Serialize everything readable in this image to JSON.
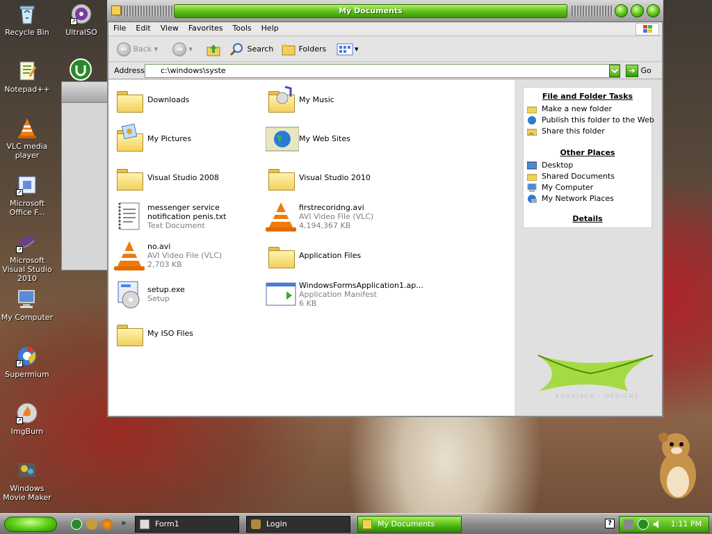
{
  "desktop": {
    "icons": [
      {
        "label": "Recycle Bin",
        "icon": "recycle-bin-icon"
      },
      {
        "label": "UltraISO",
        "icon": "ultraiso-icon"
      },
      {
        "label": "Notepad++",
        "icon": "notepad-plus-plus-icon"
      },
      {
        "label": "VLC media player",
        "icon": "vlc-icon"
      },
      {
        "label": "Microsoft Office F...",
        "icon": "office-icon"
      },
      {
        "label": "Microsoft Visual Studio 2010",
        "icon": "visual-studio-icon"
      },
      {
        "label": "My Computer",
        "icon": "my-computer-icon"
      },
      {
        "label": "Supermium",
        "icon": "supermium-icon"
      },
      {
        "label": "ImgBurn",
        "icon": "imgburn-icon"
      },
      {
        "label": "Windows Movie Maker",
        "icon": "movie-maker-icon"
      }
    ]
  },
  "window": {
    "title": "My Documents",
    "menu": [
      "File",
      "Edit",
      "View",
      "Favorites",
      "Tools",
      "Help"
    ],
    "toolbar": {
      "back": "Back",
      "search": "Search",
      "folders": "Folders"
    },
    "address": {
      "label": "Address",
      "value": "c:\\windows\\syste",
      "go": "Go"
    },
    "items": [
      {
        "name": "Downloads",
        "type": "",
        "size": "",
        "icon": "folder-icon"
      },
      {
        "name": "My Music",
        "type": "",
        "size": "",
        "icon": "music-folder-icon"
      },
      {
        "name": "My Pictures",
        "type": "",
        "size": "",
        "icon": "pictures-folder-icon"
      },
      {
        "name": "My Web Sites",
        "type": "",
        "size": "",
        "icon": "web-sites-folder-icon"
      },
      {
        "name": "Visual Studio 2008",
        "type": "",
        "size": "",
        "icon": "folder-icon"
      },
      {
        "name": "Visual Studio 2010",
        "type": "",
        "size": "",
        "icon": "folder-icon"
      },
      {
        "name": "messenger service notification penis.txt",
        "type": "Text Document",
        "size": "",
        "icon": "text-document-icon"
      },
      {
        "name": "firstrecoridng.avi",
        "type": "AVI Video File (VLC)",
        "size": "4,194,367 KB",
        "icon": "vlc-icon"
      },
      {
        "name": "no.avi",
        "type": "AVI Video File (VLC)",
        "size": "2,703 KB",
        "icon": "vlc-icon"
      },
      {
        "name": "Application Files",
        "type": "",
        "size": "",
        "icon": "folder-icon"
      },
      {
        "name": "setup.exe",
        "type": "Setup",
        "size": "",
        "icon": "setup-icon"
      },
      {
        "name": "WindowsFormsApplication1.ap...",
        "type": "Application Manifest",
        "size": "6 KB",
        "icon": "manifest-icon"
      },
      {
        "name": "My ISO Files",
        "type": "",
        "size": "",
        "icon": "folder-icon"
      }
    ],
    "side": {
      "file_tasks_title": "File and Folder Tasks",
      "file_tasks": [
        "Make a new folder",
        "Publish this folder to the Web",
        "Share this folder"
      ],
      "other_places_title": "Other Places",
      "other_places": [
        "Desktop",
        "Shared Documents",
        "My Computer",
        "My Network Places"
      ],
      "details_title": "Details"
    },
    "watermark": "AQUAJACK · DESIGNS"
  },
  "taskbar": {
    "buttons": [
      {
        "label": "Form1",
        "active": false
      },
      {
        "label": "Login",
        "active": false
      },
      {
        "label": "My Documents",
        "active": true
      }
    ],
    "chevron": "»",
    "help_glyph": "?",
    "clock": "1:11 PM"
  },
  "colors": {
    "accent_green": "#5dc218",
    "window_gray": "#dcdcdc"
  }
}
